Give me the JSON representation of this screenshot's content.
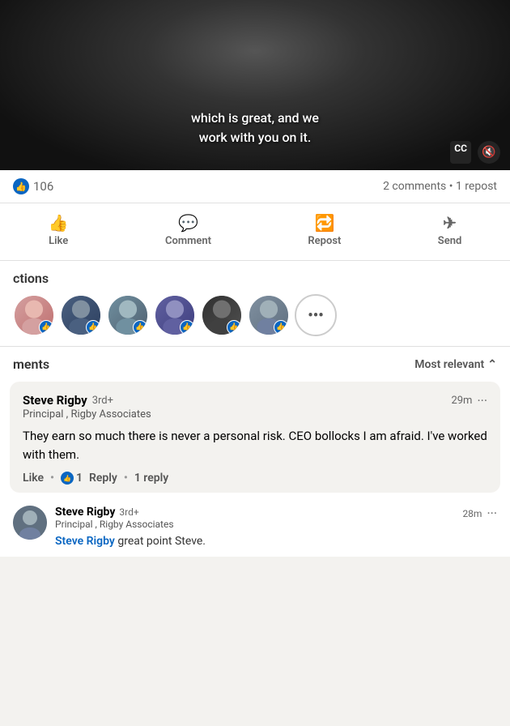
{
  "video": {
    "subtitle_line1": "which is great, and we",
    "subtitle_line2": "work with you on it.",
    "cc_label": "CC",
    "mute_icon": "🔇"
  },
  "stats": {
    "like_count": "106",
    "comments_count": "2 comments",
    "separator": "•",
    "repost_count": "1 repost"
  },
  "actions": [
    {
      "label": "Like",
      "icon": "👍"
    },
    {
      "label": "Comment",
      "icon": "💬"
    },
    {
      "label": "Repost",
      "icon": "🔁"
    },
    {
      "label": "Send",
      "icon": "✈"
    }
  ],
  "reactions": {
    "title": "ctions",
    "avatars": [
      {
        "color": "av1",
        "initial": ""
      },
      {
        "color": "av2",
        "initial": ""
      },
      {
        "color": "av3",
        "initial": ""
      },
      {
        "color": "av4",
        "initial": ""
      },
      {
        "color": "av5",
        "initial": ""
      },
      {
        "color": "av6",
        "initial": ""
      }
    ],
    "more_icon": "···"
  },
  "comments": {
    "title": "ments",
    "sort_label": "Most relevant",
    "sort_icon": "⌃",
    "items": [
      {
        "id": "comment-1",
        "author": "Steve Rigby",
        "degree": "3rd+",
        "job_title": "Principal , Rigby Associates",
        "time": "29m",
        "text": "They earn so much there is never a personal risk. CEO bollocks I am afraid. I've worked with them.",
        "like_count": "1",
        "reply_label": "Reply",
        "replies_label": "1 reply",
        "more_label": "···"
      }
    ]
  },
  "reply": {
    "author": "Steve Rigby",
    "degree": "3rd+",
    "job_title": "Principal , Rigby Associates",
    "time": "28m",
    "more_label": "···",
    "mention": "Steve Rigby",
    "text": " great point Steve.",
    "avatar_color": "av6"
  }
}
